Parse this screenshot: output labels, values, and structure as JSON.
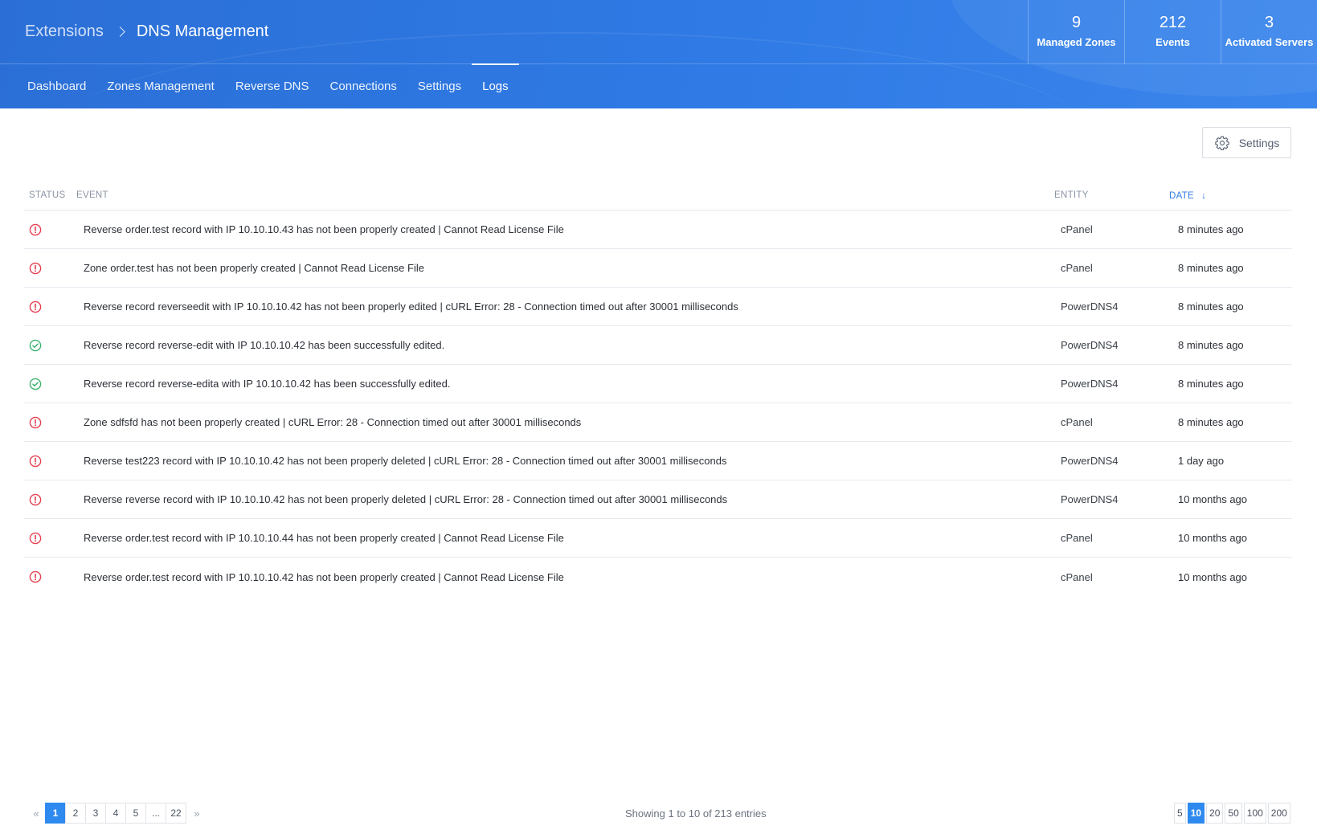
{
  "breadcrumb": {
    "root": "Extensions",
    "current": "DNS Management"
  },
  "stats": [
    {
      "value": "9",
      "label": "Managed Zones"
    },
    {
      "value": "212",
      "label": "Events"
    },
    {
      "value": "3",
      "label": "Activated Servers"
    }
  ],
  "tabs": [
    {
      "label": "Dashboard",
      "active": false
    },
    {
      "label": "Zones Management",
      "active": false
    },
    {
      "label": "Reverse DNS",
      "active": false
    },
    {
      "label": "Connections",
      "active": false
    },
    {
      "label": "Settings",
      "active": false
    },
    {
      "label": "Logs",
      "active": true
    }
  ],
  "toolbar": {
    "settings_label": "Settings",
    "settings_icon": "gear-icon"
  },
  "table": {
    "headers": {
      "status": "STATUS",
      "event": "EVENT",
      "entity": "ENTITY",
      "date": "DATE"
    },
    "sort": {
      "column": "date",
      "direction": "desc"
    },
    "rows": [
      {
        "status": "error",
        "event": "Reverse order.test record with IP 10.10.10.43 has not been properly created | Cannot Read License File",
        "entity": "cPanel",
        "date": "8 minutes ago"
      },
      {
        "status": "error",
        "event": "Zone order.test has not been properly created | Cannot Read License File",
        "entity": "cPanel",
        "date": "8 minutes ago"
      },
      {
        "status": "error",
        "event": "Reverse record reverseedit with IP 10.10.10.42 has not been properly edited | cURL Error: 28 - Connection timed out after 30001 milliseconds",
        "entity": "PowerDNS4",
        "date": "8 minutes ago"
      },
      {
        "status": "success",
        "event": "Reverse record reverse-edit with IP 10.10.10.42 has been successfully edited.",
        "entity": "PowerDNS4",
        "date": "8 minutes ago"
      },
      {
        "status": "success",
        "event": "Reverse record reverse-edita with IP 10.10.10.42 has been successfully edited.",
        "entity": "PowerDNS4",
        "date": "8 minutes ago"
      },
      {
        "status": "error",
        "event": "Zone sdfsfd has not been properly created | cURL Error: 28 - Connection timed out after 30001 milliseconds",
        "entity": "cPanel",
        "date": "8 minutes ago"
      },
      {
        "status": "error",
        "event": "Reverse test223 record with IP 10.10.10.42 has not been properly deleted | cURL Error: 28 - Connection timed out after 30001 milliseconds",
        "entity": "PowerDNS4",
        "date": "1 day ago"
      },
      {
        "status": "error",
        "event": "Reverse reverse record with IP 10.10.10.42 has not been properly deleted | cURL Error: 28 - Connection timed out after 30001 milliseconds",
        "entity": "PowerDNS4",
        "date": "10 months ago"
      },
      {
        "status": "error",
        "event": "Reverse order.test record with IP 10.10.10.44 has not been properly created | Cannot Read License File",
        "entity": "cPanel",
        "date": "10 months ago"
      },
      {
        "status": "error",
        "event": "Reverse order.test record with IP 10.10.10.42 has not been properly created | Cannot Read License File",
        "entity": "cPanel",
        "date": "10 months ago"
      }
    ]
  },
  "pagination": {
    "pages": [
      "1",
      "2",
      "3",
      "4",
      "5",
      "...",
      "22"
    ],
    "current": "1",
    "showing": "Showing 1 to 10 of 213 entries",
    "per_page_options": [
      "5",
      "10",
      "20",
      "50",
      "100",
      "200"
    ],
    "per_page_selected": "10"
  },
  "colors": {
    "header": "#2f7ae5",
    "accent": "#2f8af0",
    "error": "#e53e4f",
    "success": "#3cb371"
  }
}
